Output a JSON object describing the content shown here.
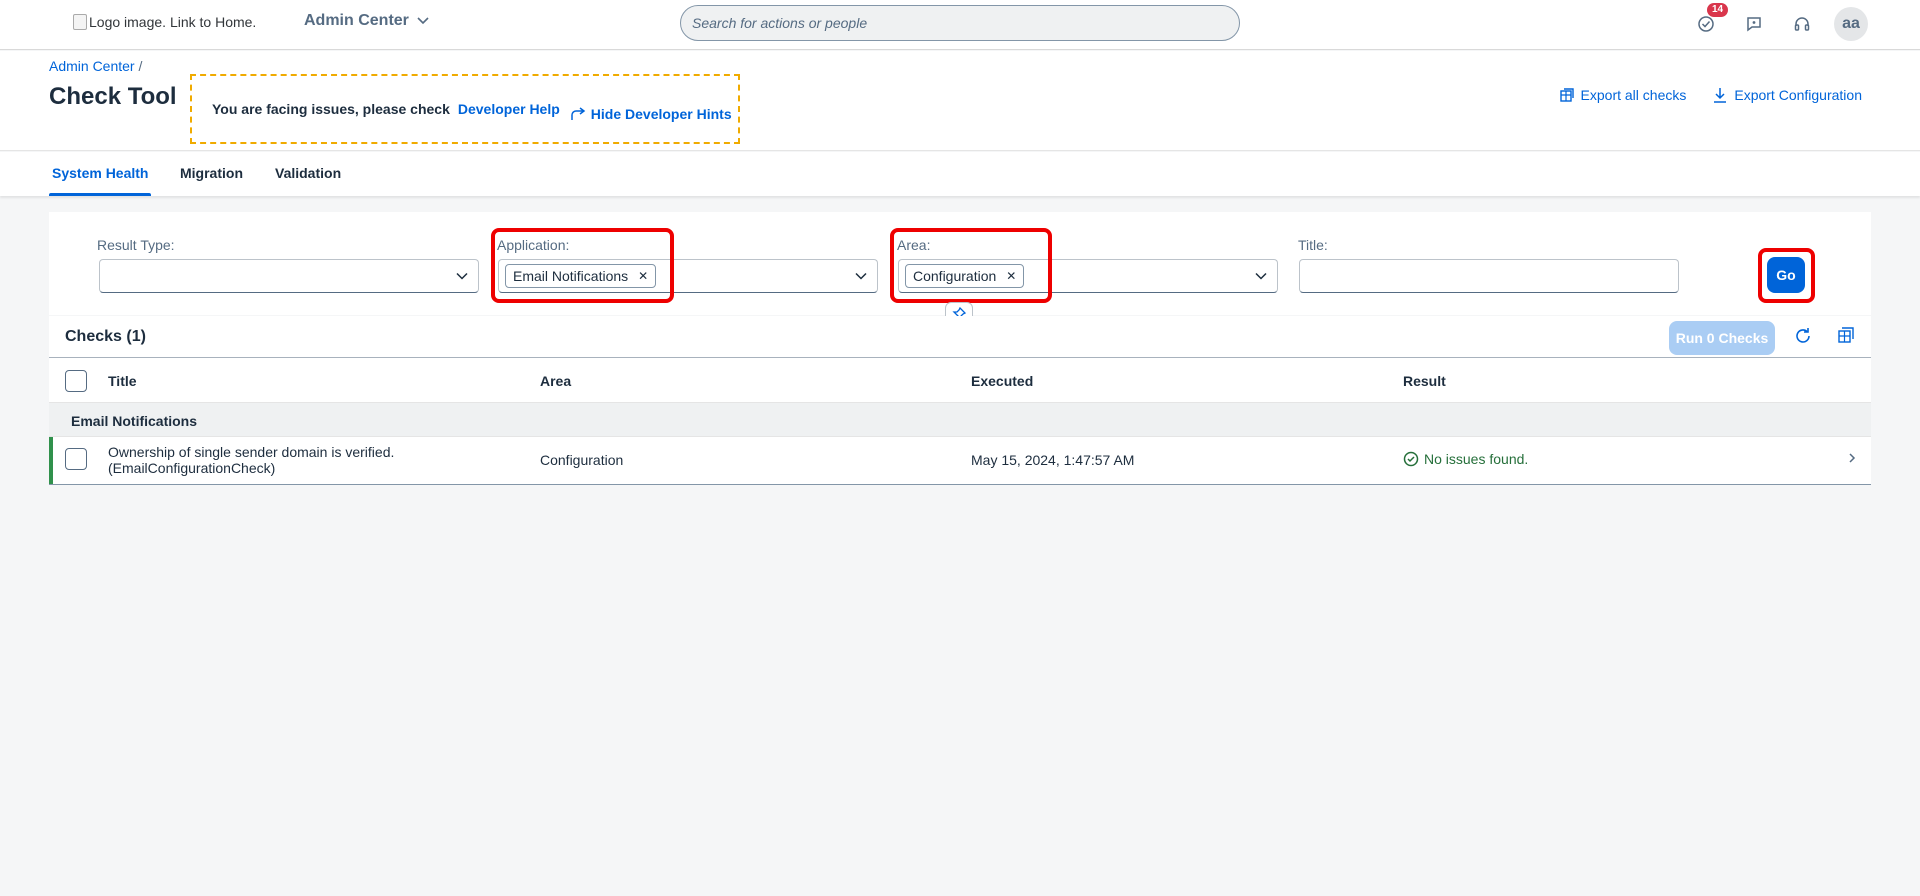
{
  "shell": {
    "logo_alt": "Logo image. Link to Home.",
    "product": "Admin Center",
    "search_placeholder": "Search for actions or people",
    "notification_count": "14",
    "avatar_initials": "aa"
  },
  "header": {
    "breadcrumb": "Admin Center",
    "breadcrumb_sep": "/",
    "title": "Check Tool",
    "hint_text": "You are facing issues, please check",
    "hint_link": "Developer Help",
    "hint_hide": "Hide Developer Hints",
    "export_checks": "Export all checks",
    "export_config": "Export Configuration"
  },
  "tabs": [
    {
      "label": "System Health",
      "active": true
    },
    {
      "label": "Migration",
      "active": false
    },
    {
      "label": "Validation",
      "active": false
    }
  ],
  "filters": {
    "result_type_label": "Result Type:",
    "application_label": "Application:",
    "application_token": "Email Notifications",
    "area_label": "Area:",
    "area_token": "Configuration",
    "title_label": "Title:",
    "go_label": "Go",
    "highlight_color": "#ee0000"
  },
  "table": {
    "title": "Checks (1)",
    "run_label": "Run 0 Checks",
    "columns": [
      "Title",
      "Area",
      "Executed",
      "Result"
    ],
    "group": "Email Notifications",
    "rows": [
      {
        "title_line1": "Ownership of single sender domain is verified.",
        "title_line2": "(EmailConfigurationCheck)",
        "area": "Configuration",
        "executed": "May 15, 2024, 1:47:57 AM",
        "result": "No issues found."
      }
    ]
  }
}
